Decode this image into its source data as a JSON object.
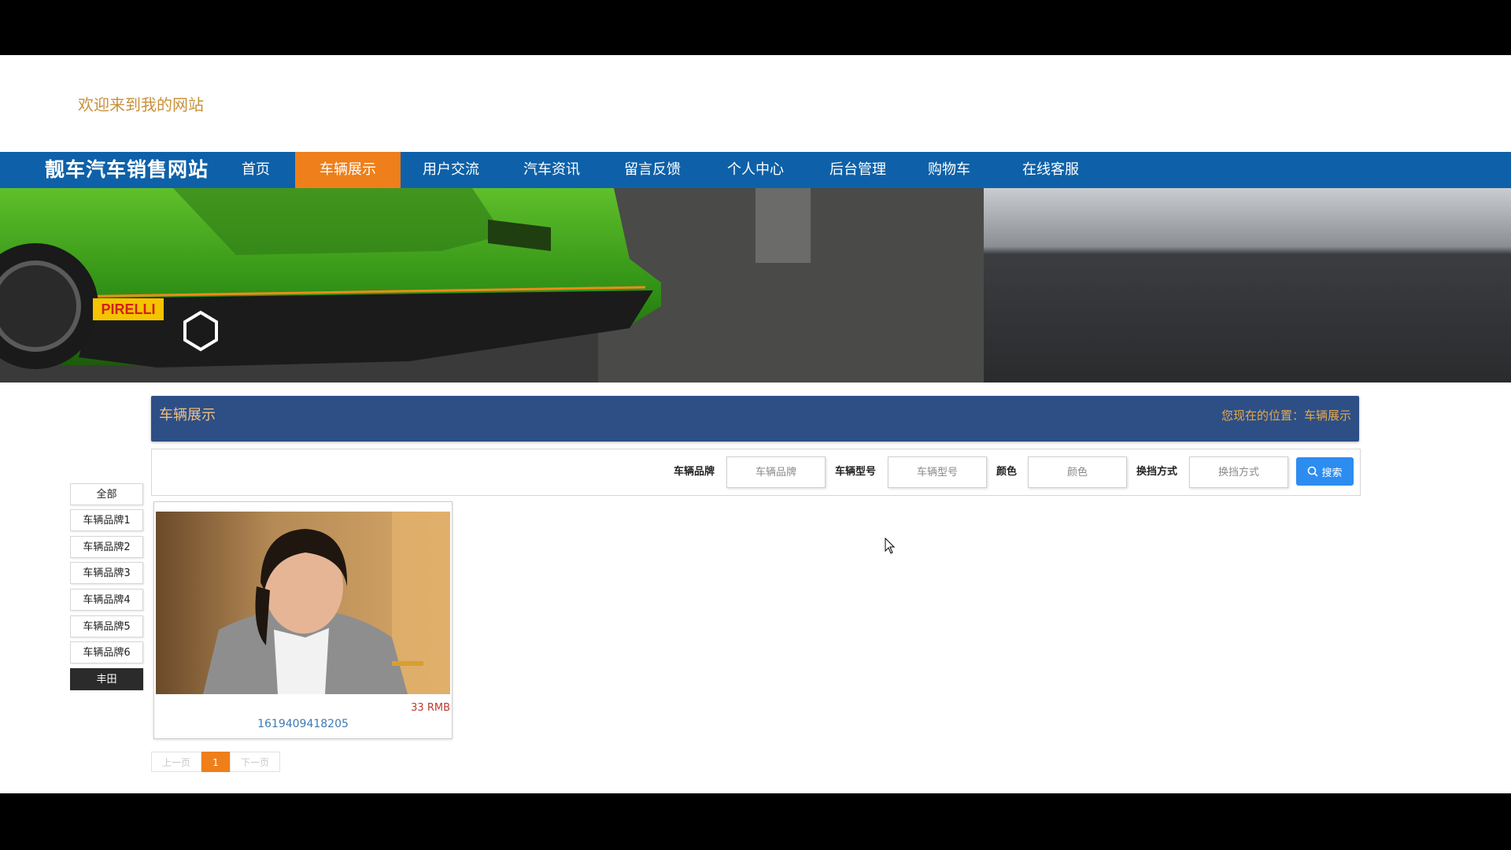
{
  "header": {
    "welcome": "欢迎来到我的网站"
  },
  "nav": {
    "brand": "靓车汽车销售网站",
    "items": [
      "首页",
      "车辆展示",
      "用户交流",
      "汽车资讯",
      "留言反馈",
      "个人中心",
      "后台管理",
      "购物车",
      "在线客服"
    ],
    "active_index": 1
  },
  "banner": {
    "sponsor_text": "PIRELLI",
    "slide_count": 3,
    "active_slide": 0
  },
  "section": {
    "title": "车辆展示",
    "breadcrumb": "您现在的位置：车辆展示"
  },
  "filters": {
    "brand_label": "车辆品牌",
    "brand_placeholder": "车辆品牌",
    "model_label": "车辆型号",
    "model_placeholder": "车辆型号",
    "color_label": "颜色",
    "color_placeholder": "颜色",
    "gear_label": "换挡方式",
    "gear_placeholder": "换挡方式",
    "search_label": "搜索"
  },
  "categories": [
    "全部",
    "车辆品牌1",
    "车辆品牌2",
    "车辆品牌3",
    "车辆品牌4",
    "车辆品牌5",
    "车辆品牌6",
    "丰田"
  ],
  "selected_category": 7,
  "product": {
    "price": "33 RMB",
    "name": "1619409418205"
  },
  "pagination": {
    "prev": "上一页",
    "current": "1",
    "next": "下一页"
  },
  "colors": {
    "nav": "#0e61a8",
    "accent": "#ee7f1a",
    "section": "#2d4f86",
    "search": "#2d8cf0"
  }
}
